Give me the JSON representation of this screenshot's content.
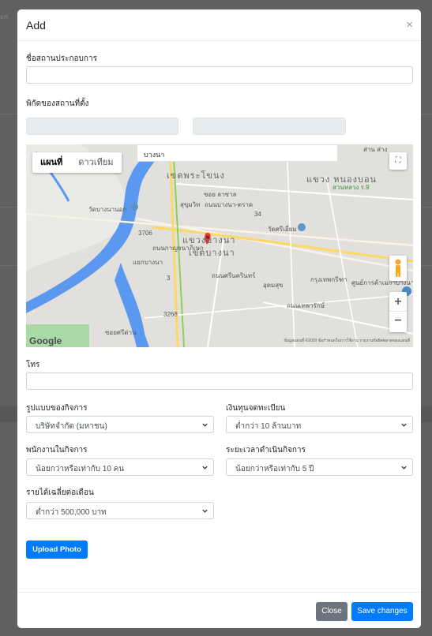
{
  "backdrop": {
    "partial_text": "ะก"
  },
  "modal": {
    "title": "Add",
    "close_icon": "close-icon"
  },
  "form": {
    "business_name": {
      "label": "ชื่อสถานประกอบการ",
      "value": ""
    },
    "location": {
      "label": "พิกัดของสถานที่ตั้ง",
      "lat": "",
      "lng": ""
    },
    "phone": {
      "label": "โทร",
      "value": ""
    },
    "business_type": {
      "label": "รูปแบบของกิจการ",
      "selected": "บริษัทจำกัด (มหาชน)"
    },
    "registered_capital": {
      "label": "เงินทุนจดทะเบียน",
      "selected": "ต่ำกว่า 10 ล้านบาท"
    },
    "employees": {
      "label": "พนักงานในกิจการ",
      "selected": "น้อยกว่าหรือเท่ากับ 10 คน"
    },
    "operating_period": {
      "label": "ระยะเวลาดำเนินกิจการ",
      "selected": "น้อยกว่าหรือเท่ากับ 5 ปี"
    },
    "monthly_income": {
      "label": "รายได้เฉลี่ยต่อเดือน",
      "selected": "ต่ำกว่า 500,000 บาท"
    }
  },
  "map": {
    "type_map": "แผนที่",
    "type_satellite": "ดาวเทียม",
    "search_value": "บางนา",
    "zoom_in": "+",
    "zoom_out": "−",
    "logo": "Google",
    "attribution": "ข้อมูลแผนที่ ©2020   ข้อกำหนดในการใช้งาน   รายงานข้อผิดพลาดของแผนที่",
    "labels": {
      "top_right": "ส่าน ส่าง",
      "district_prakhanong": "เขตพระโขนง",
      "khwaeng_nongbon": "แขวง หนองบอน",
      "suan_luang": "สวนหลวง ร.9",
      "wat_bang_na_nok": "วัดบางนานอก",
      "wat_si_iam": "วัดศรีเอี่ยม",
      "khwaeng_bang_na": "แขวงบางนา",
      "khet_bang_na": "เขตบางนา",
      "bangna_center": "ศูนย์การค้าเมกาบางนา",
      "road_3706": "3706",
      "road_3": "3",
      "road_3268": "3268",
      "road_34": "34",
      "soi_lasalle": "ซอย ลาซาล",
      "bangna_road": "ถนนบางนา-ตราด",
      "sukhumvit": "สุขุมวิท",
      "kanchanaphisek": "ถนนกาญจนาภิเษก",
      "bang_na_intersection": "แยกบางนา",
      "srinagarindra": "ถนนศรีนครินทร์",
      "udomsuk": "อุดมสุข",
      "srinakarin_soi": "ซอยศรีด่าน",
      "khlong_bang_na": "กรุงเทพกรีฑา",
      "south_label": "ถนนเทพารักษ์"
    }
  },
  "buttons": {
    "upload": "Upload Photo",
    "close": "Close",
    "save": "Save changes"
  },
  "colors": {
    "primary": "#007bff",
    "secondary": "#6c757d",
    "backdrop": "#606060"
  }
}
